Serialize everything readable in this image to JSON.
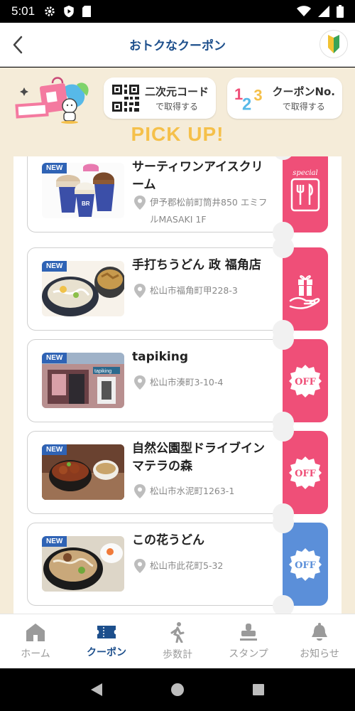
{
  "status": {
    "time": "5:01"
  },
  "header": {
    "title": "おトクなクーポン"
  },
  "actions": {
    "qr": {
      "main": "二次元コード",
      "sub": "で取得する"
    },
    "coupon_no": {
      "main": "クーポンNo.",
      "sub": "で取得する"
    }
  },
  "pickup_title": "PICK UP!",
  "coupons": [
    {
      "badge": "NEW",
      "name": "サーティワンアイスクリーム",
      "address": "伊予郡松前町筒井850 エミフルMASAKI 1F",
      "tab": "special",
      "tab_color": "#ef4f78"
    },
    {
      "badge": "NEW",
      "name": "手打ちうどん 政 福角店",
      "address": "松山市福角町甲228-3",
      "tab": "gift",
      "tab_color": "#ef4f78"
    },
    {
      "badge": "NEW",
      "name": "tapiking",
      "address": "松山市湊町3-10-4",
      "tab": "OFF",
      "tab_color": "#ef4f78"
    },
    {
      "badge": "NEW",
      "name": "自然公園型ドライブイン マテラの森",
      "address": "松山市水泥町1263-1",
      "tab": "OFF",
      "tab_color": "#ef4f78"
    },
    {
      "badge": "NEW",
      "name": "この花うどん",
      "address": "松山市此花町5-32",
      "tab": "OFF",
      "tab_color": "#5b8fd9"
    }
  ],
  "nav": [
    {
      "label": "ホーム",
      "icon": "home-icon"
    },
    {
      "label": "クーポン",
      "icon": "ticket-icon",
      "active": true
    },
    {
      "label": "歩数計",
      "icon": "walk-icon"
    },
    {
      "label": "スタンプ",
      "icon": "stamp-icon"
    },
    {
      "label": "お知らせ",
      "icon": "bell-icon"
    }
  ],
  "colors": {
    "accent": "#1d4f8c",
    "pink": "#ef4f78",
    "blue": "#5b8fd9",
    "pickup": "#f5c04a",
    "background": "#f5ecd9"
  }
}
